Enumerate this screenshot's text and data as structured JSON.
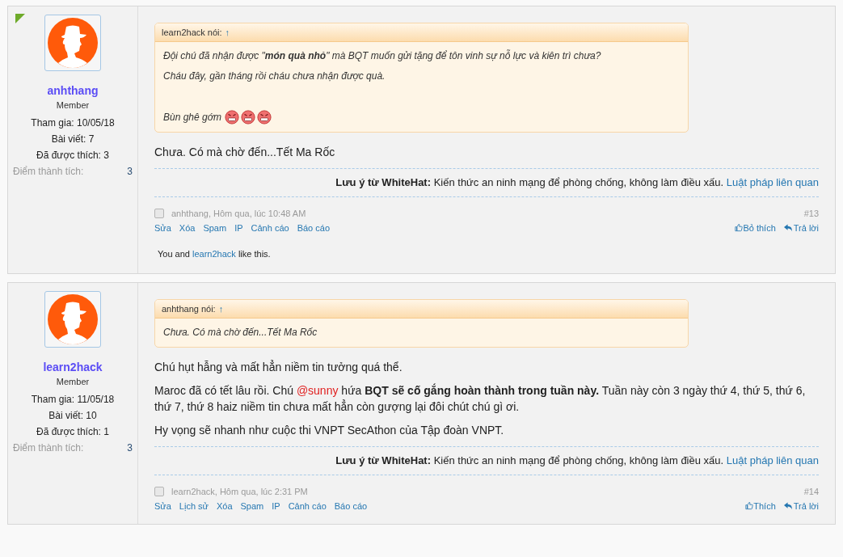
{
  "posts": [
    {
      "unread": true,
      "user": {
        "name": "anhthang",
        "title": "Member",
        "stats": [
          "Tham gia: 10/05/18",
          "Bài viết: 7",
          "Đã được thích: 3"
        ],
        "points_label": "Điểm thành tích:",
        "points_value": "3"
      },
      "quote": {
        "author": "learn2hack nói:",
        "arrow": "↑",
        "lines": [
          {
            "kind": "text",
            "text": "Đội chú đã nhận được \"**món quà nhỏ**\" mà BQT muốn gửi tặng để tôn vinh sự nỗ lực và kiên trì chưa?"
          },
          {
            "kind": "text",
            "text": "Cháu đây, gần tháng rồi cháu chưa nhận được quà."
          },
          {
            "kind": "blank"
          },
          {
            "kind": "text",
            "text": "Bùn ghê gớm",
            "emojis": [
              {
                "kind": "angry"
              },
              {
                "kind": "angry"
              },
              {
                "kind": "angry"
              }
            ]
          }
        ]
      },
      "paragraphs": [
        [
          {
            "kind": "text",
            "text": "Chưa. Có mà chờ đến...Tết Ma Rốc"
          }
        ]
      ],
      "notice": {
        "text": "**Lưu ý từ WhiteHat:** Kiến thức an ninh mạng để phòng chống, không làm điều xấu.",
        "link": "Luật pháp liên quan"
      },
      "footer": {
        "checked": false,
        "byline": "anhthang, Hôm qua, lúc 10:48 AM",
        "actions": [
          "Sửa",
          "Xóa",
          "Spam",
          "IP",
          "Cảnh cáo",
          "Báo cáo"
        ],
        "number": "#13",
        "like": "Bỏ thích",
        "reply": "Trả lời"
      },
      "likes": [
        {
          "kind": "text",
          "text": "You and "
        },
        {
          "kind": "link",
          "text": "learn2hack"
        },
        {
          "kind": "text",
          "text": " like this."
        }
      ]
    },
    {
      "unread": false,
      "user": {
        "name": "learn2hack",
        "title": "Member",
        "stats": [
          "Tham gia: 11/05/18",
          "Bài viết: 10",
          "Đã được thích: 1"
        ],
        "points_label": "Điểm thành tích:",
        "points_value": "3"
      },
      "quote": {
        "author": "anhthang nói:",
        "arrow": "↑",
        "lines": [
          {
            "kind": "text",
            "text": "Chưa. Có mà chờ đến...Tết Ma Rốc"
          }
        ]
      },
      "paragraphs": [
        [
          {
            "kind": "text",
            "text": "Chú hụt hẫng và mất hẳn niềm tin tưởng quá thể."
          }
        ],
        [
          {
            "kind": "text",
            "text": "Maroc đã có tết lâu rồi. Chú "
          },
          {
            "kind": "mention",
            "text": "@sunny"
          },
          {
            "kind": "text",
            "text": " hứa "
          },
          {
            "kind": "bold",
            "text": "BQT sẽ cố gắng hoàn thành trong tuần này."
          },
          {
            "kind": "text",
            "text": " Tuần này còn 3 ngày thứ 4, thứ 5, thứ 6, thứ 7, thứ 8 haiz niềm tin chưa mất hẳn còn gượng lại đôi chút chú gì ơi."
          }
        ],
        [
          {
            "kind": "text",
            "text": "Hy vọng sẽ nhanh như cuộc thi VNPT SecAthon của Tập đoàn VNPT."
          }
        ]
      ],
      "notice": {
        "text": "**Lưu ý từ WhiteHat:** Kiến thức an ninh mạng để phòng chống, không làm điều xấu.",
        "link": "Luật pháp liên quan"
      },
      "footer": {
        "checked": false,
        "byline": "learn2hack, Hôm qua, lúc 2:31 PM",
        "actions": [
          "Sửa",
          "Lịch sử",
          "Xóa",
          "Spam",
          "IP",
          "Cảnh cáo",
          "Báo cáo"
        ],
        "number": "#14",
        "like": "Thích",
        "reply": "Trả lời"
      }
    }
  ]
}
